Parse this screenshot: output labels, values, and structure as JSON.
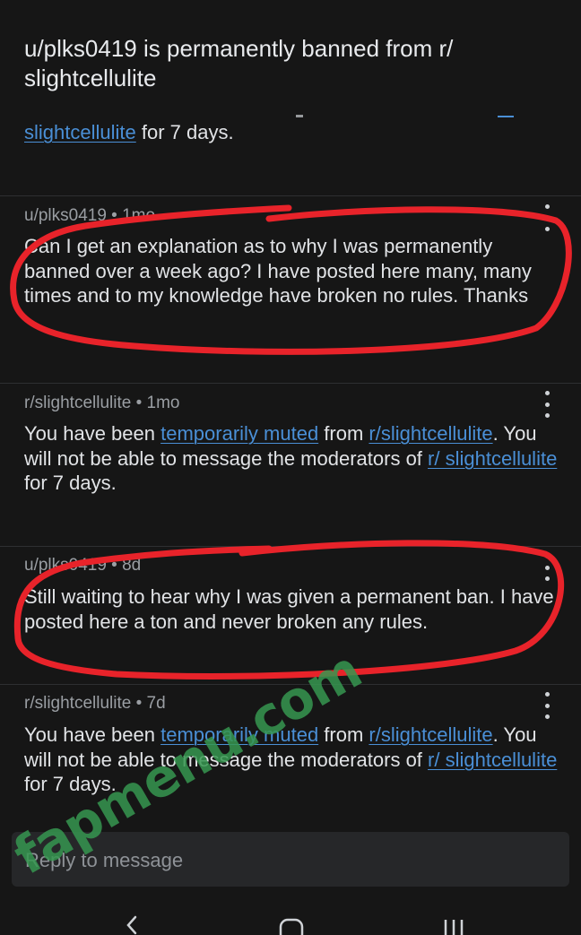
{
  "thread": {
    "title": "u/plks0419 is permanently banned from r/ slightcellulite"
  },
  "messages": [
    {
      "partial": true,
      "link_tail": "slightcellulite",
      "text_tail": " for 7 days."
    },
    {
      "author": "u/plks0419",
      "age": "1mo",
      "meta": "u/plks0419 • 1mo",
      "body": "Can I get an explanation as to why I was permanently banned over a week ago? I have posted here many, many times and to my knowledge have broken no rules. Thanks"
    },
    {
      "author": "r/slightcellulite",
      "age": "1mo",
      "meta": "r/slightcellulite • 1mo",
      "text_1": "You have been ",
      "link_1": "temporarily muted",
      "text_2": " from ",
      "link_2": "r/slightcellulite",
      "text_3": ". You will not be able to message the moderators of ",
      "link_3": "r/ slightcellulite",
      "text_4": " for 7 days."
    },
    {
      "author": "u/plks0419",
      "age": "8d",
      "meta": "u/plks0419 • 8d",
      "body": "Still waiting to hear why I was given a permanent ban. I have posted here a ton and never broken any rules."
    },
    {
      "author": "r/slightcellulite",
      "age": "7d",
      "meta": "r/slightcellulite • 7d",
      "text_1": "You have been ",
      "link_1": "temporarily muted",
      "text_2": " from ",
      "link_2": "r/slightcellulite",
      "text_3": ". You will not be able to message the moderators of ",
      "link_3": "r/ slightcellulite",
      "text_4": " for 7 days."
    }
  ],
  "reply": {
    "placeholder": "Reply to message"
  },
  "watermark": "fapmenu.com",
  "colors": {
    "background": "#161616",
    "link": "#4a8fd6",
    "annotation": "#e8232a",
    "watermark": "#369650"
  },
  "icons": [
    "more-options-icon",
    "back-icon",
    "home-icon",
    "recent-apps-icon"
  ]
}
